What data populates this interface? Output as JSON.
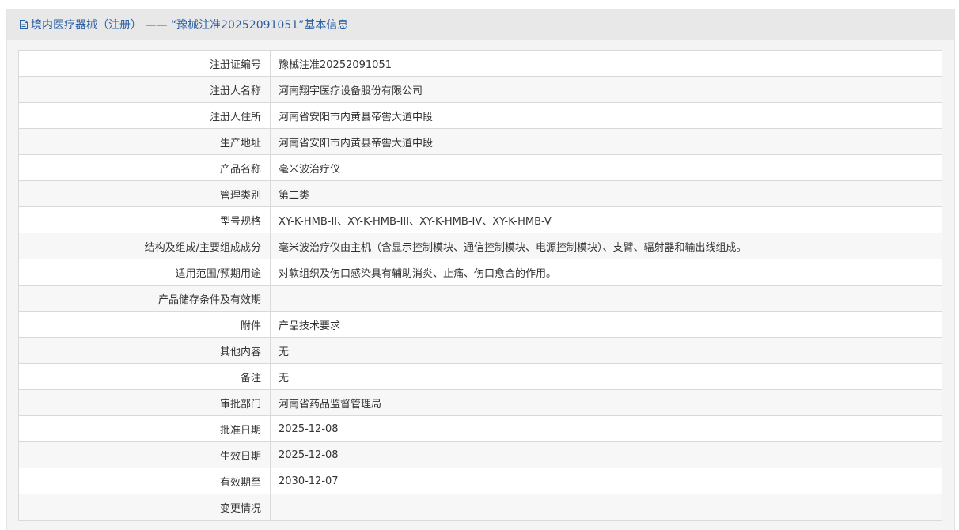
{
  "panel": {
    "title": "境内医疗器械（注册） —— “豫械注准20252091051”基本信息",
    "title_icon": "document-icon",
    "accent_color": "#2b5fa3"
  },
  "rows": [
    {
      "label": "注册证编号",
      "value": "豫械注准20252091051"
    },
    {
      "label": "注册人名称",
      "value": "河南翔宇医疗设备股份有限公司"
    },
    {
      "label": "注册人住所",
      "value": "河南省安阳市内黄县帝喾大道中段"
    },
    {
      "label": "生产地址",
      "value": "河南省安阳市内黄县帝喾大道中段"
    },
    {
      "label": "产品名称",
      "value": "毫米波治疗仪"
    },
    {
      "label": "管理类别",
      "value": "第二类"
    },
    {
      "label": "型号规格",
      "value": "XY-K-HMB-II、XY-K-HMB-III、XY-K-HMB-IV、XY-K-HMB-V"
    },
    {
      "label": "结构及组成/主要组成成分",
      "value": "毫米波治疗仪由主机（含显示控制模块、通信控制模块、电源控制模块）、支臂、辐射器和输出线组成。"
    },
    {
      "label": "适用范围/预期用途",
      "value": "对软组织及伤口感染具有辅助消炎、止痛、伤口愈合的作用。"
    },
    {
      "label": "产品储存条件及有效期",
      "value": ""
    },
    {
      "label": "附件",
      "value": "产品技术要求"
    },
    {
      "label": "其他内容",
      "value": "无"
    },
    {
      "label": "备注",
      "value": "无"
    },
    {
      "label": "审批部门",
      "value": "河南省药品监督管理局"
    },
    {
      "label": "批准日期",
      "value": "2025-12-08"
    },
    {
      "label": "生效日期",
      "value": "2025-12-08"
    },
    {
      "label": "有效期至",
      "value": "2030-12-07"
    },
    {
      "label": "变更情况",
      "value": ""
    }
  ]
}
